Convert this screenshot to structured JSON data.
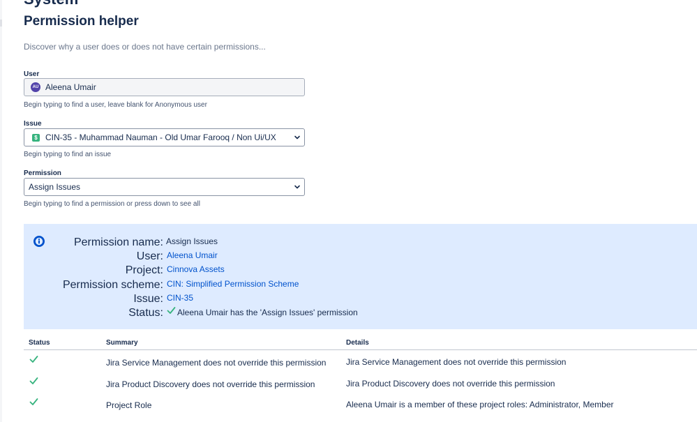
{
  "header": {
    "section_title_clipped": "System",
    "title": "Permission helper",
    "description": "Discover why a user does or does not have certain permissions..."
  },
  "form": {
    "user": {
      "label": "User",
      "avatar_initials": "AU",
      "value": "Aleena Umair",
      "help": "Begin typing to find a user, leave blank for Anonymous user"
    },
    "issue": {
      "label": "Issue",
      "icon": "story-icon",
      "icon_glyph": "$",
      "value": "CIN-35 - Muhammad Nauman - Old Umar Farooq / Non Ui/UX",
      "help": "Begin typing to find an issue"
    },
    "permission": {
      "label": "Permission",
      "value": "Assign Issues",
      "help": "Begin typing to find a permission or press down to see all"
    }
  },
  "result": {
    "permission_name_label": "Permission name:",
    "permission_name": "Assign Issues",
    "user_label": "User:",
    "user": "Aleena Umair",
    "project_label": "Project:",
    "project": "Cinnova Assets",
    "scheme_label": "Permission scheme:",
    "scheme": "CIN: Simplified Permission Scheme",
    "issue_label": "Issue:",
    "issue": "CIN-35",
    "status_label": "Status:",
    "status": "Aleena Umair has the 'Assign Issues' permission"
  },
  "table": {
    "headers": {
      "status": "Status",
      "summary": "Summary",
      "details": "Details"
    },
    "rows": [
      {
        "summary": "Jira Service Management does not override this permission",
        "details": "Jira Service Management does not override this permission"
      },
      {
        "summary": "Jira Product Discovery does not override this permission",
        "details": "Jira Product Discovery does not override this permission"
      },
      {
        "summary": "Project Role",
        "details": "Aleena Umair is a member of these project roles: Administrator, Member"
      }
    ]
  },
  "colors": {
    "panel_bg": "#deebff",
    "link": "#0052cc",
    "success": "#36b37e",
    "avatar": "#5243aa"
  }
}
